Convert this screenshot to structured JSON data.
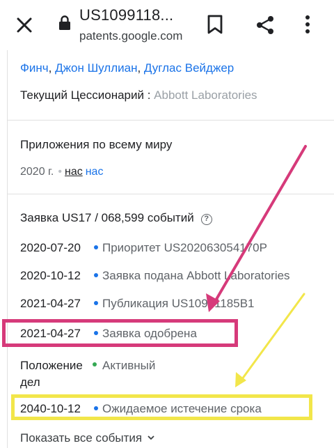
{
  "browser": {
    "title": "US1099118...",
    "domain": "patents.google.com"
  },
  "patent": {
    "inventors_partial": "Финч, Джон Шуллиан, Дуглас Вейджер",
    "inventor_1": "Финч",
    "inventor_2": "Джон Шуллиан",
    "inventor_3": "Дуглас Вейджер",
    "assignee_label": "Текущий Цессионарий :",
    "assignee_value": "Abbott Laboratories",
    "worldwide_title": "Приложения по всему миру",
    "worldwide_year": "2020 г.",
    "worldwide_link1": "нас",
    "worldwide_link2": "нас",
    "application_title": "Заявка US17 / 068,599 событий",
    "events": [
      {
        "date": "2020-07-20",
        "desc": "Приоритет US202063054170P"
      },
      {
        "date": "2020-10-12",
        "desc": "Заявка подана Abbott Laboratories"
      },
      {
        "date": "2021-04-27",
        "desc": "Публикация US10991185B1"
      },
      {
        "date": "2021-04-27",
        "desc": "Заявка одобрена"
      }
    ],
    "status_label_1": "Положение",
    "status_label_2": "дел",
    "status_value": "Активный",
    "expiry_date": "2040-10-12",
    "expiry_desc": "Ожидаемое истечение срока",
    "show_all": "Показать все события"
  },
  "colors": {
    "link": "#1a73e8",
    "highlight_pink": "#d63a7a",
    "highlight_yellow": "#f2e64a",
    "status_active": "#34a853"
  }
}
